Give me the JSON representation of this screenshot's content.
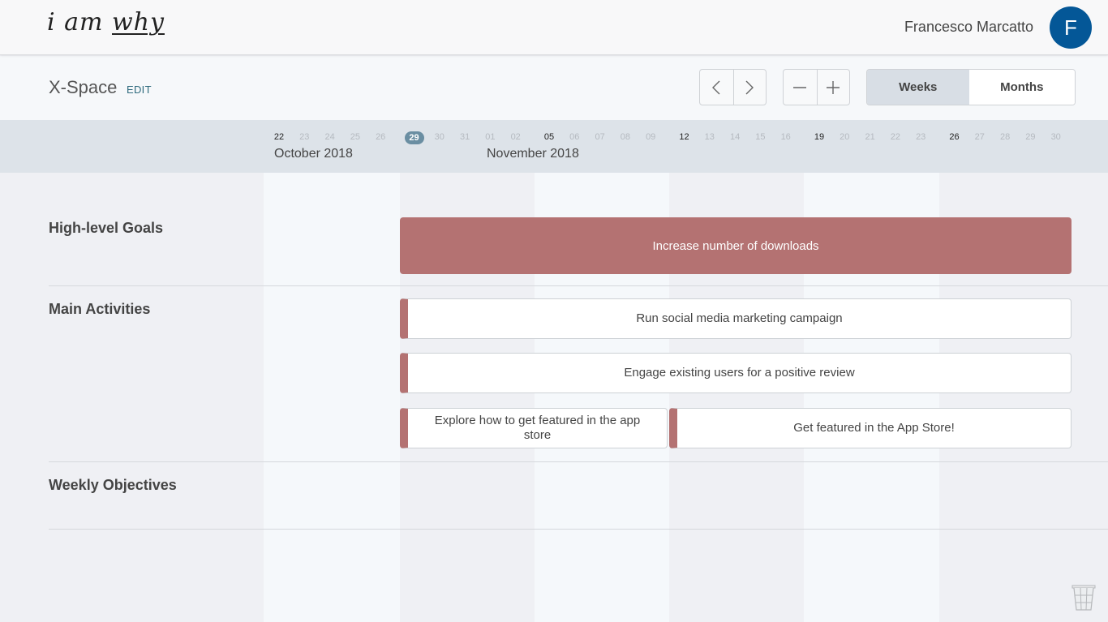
{
  "header": {
    "logo_text_prefix": "i am ",
    "logo_text_emphasis": "why",
    "user_name": "Francesco Marcatto",
    "avatar_initial": "F"
  },
  "toolbar": {
    "space_title": "X-Space",
    "edit_label": "EDIT",
    "prev_icon": "‹",
    "next_icon": "›",
    "zoom_out_icon": "−",
    "zoom_in_icon": "+",
    "view_options": [
      {
        "label": "Weeks",
        "selected": true
      },
      {
        "label": "Months",
        "selected": false
      }
    ]
  },
  "timeline": {
    "days": [
      "22",
      "23",
      "24",
      "25",
      "26",
      "29",
      "30",
      "31",
      "01",
      "02",
      "05",
      "06",
      "07",
      "08",
      "09",
      "12",
      "13",
      "14",
      "15",
      "16",
      "19",
      "20",
      "21",
      "22",
      "23",
      "26",
      "27",
      "28",
      "29",
      "30"
    ],
    "week_start_days": [
      "22",
      "05",
      "12",
      "19",
      "26"
    ],
    "today": "29",
    "months": [
      {
        "label": "October 2018"
      },
      {
        "label": "November 2018"
      }
    ]
  },
  "sections": {
    "goals": {
      "label": "High-level Goals",
      "items": [
        {
          "title": "Increase number of downloads",
          "color": "#b47272"
        }
      ]
    },
    "activities": {
      "label": "Main Activities",
      "items": [
        {
          "title": "Run social media marketing campaign"
        },
        {
          "title": "Engage existing users for a positive review"
        },
        {
          "title": "Explore how to get featured in the app store"
        },
        {
          "title": "Get featured in the App Store!"
        }
      ]
    },
    "weekly": {
      "label": "Weekly Objectives"
    }
  },
  "colors": {
    "accent": "#b47272",
    "avatar": "#045797",
    "today_badge": "#6a8ea2"
  }
}
